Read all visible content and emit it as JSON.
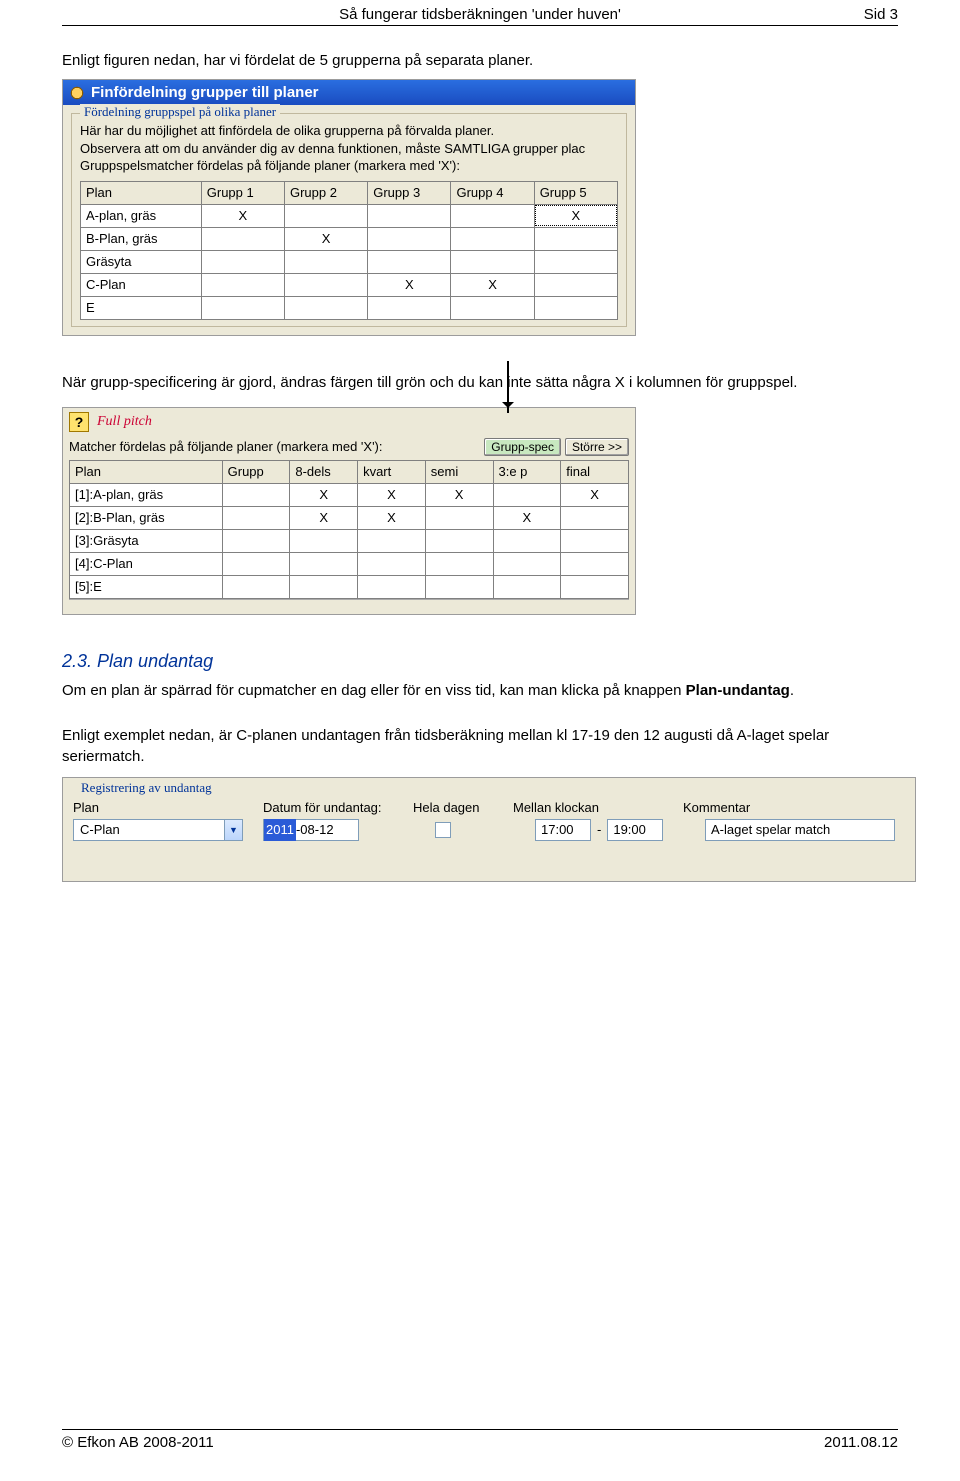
{
  "header": {
    "title": "Så fungerar tidsberäkningen 'under huven'",
    "page_label": "Sid 3"
  },
  "para1": "Enligt figuren nedan, har vi fördelat de 5 grupperna på separata planer.",
  "shot1": {
    "window_title": "Finfördelning grupper till planer",
    "fieldset_legend": "Fördelning gruppspel på olika planer",
    "desc_line1": "Här har du möjlighet att finfördela de olika grupperna på förvalda planer.",
    "desc_line2": "Observera att om du använder dig av denna funktionen, måste SAMTLIGA grupper plac",
    "desc_line3": "Gruppspelsmatcher fördelas på följande planer (markera med 'X'):",
    "cols": [
      "Plan",
      "Grupp 1",
      "Grupp 2",
      "Grupp 3",
      "Grupp 4",
      "Grupp 5"
    ],
    "rows": [
      {
        "plan": "A-plan, gräs",
        "g": [
          "X",
          "",
          "",
          "",
          "X"
        ],
        "focus_col": 5
      },
      {
        "plan": "B-Plan, gräs",
        "g": [
          "",
          "X",
          "",
          "",
          ""
        ]
      },
      {
        "plan": "Gräsyta",
        "g": [
          "",
          "",
          "",
          "",
          ""
        ]
      },
      {
        "plan": "C-Plan",
        "g": [
          "",
          "",
          "X",
          "X",
          ""
        ]
      },
      {
        "plan": "E",
        "g": [
          "",
          "",
          "",
          "",
          ""
        ]
      }
    ]
  },
  "para2": "När grupp-specificering är gjord, ändras färgen till grön och du kan inte sätta några X i kolumnen för gruppspel.",
  "shot2": {
    "fullpitch": "Full pitch",
    "label": "Matcher fördelas på följande planer (markera med 'X'):",
    "btn_gruppspec": "Grupp-spec",
    "btn_storre": "Större >>",
    "cols": [
      "Plan",
      "Grupp",
      "8-dels",
      "kvart",
      "semi",
      "3:e p",
      "final"
    ],
    "rows": [
      {
        "plan": "[1]:A-plan, gräs",
        "v": [
          "",
          "X",
          "X",
          "X",
          "",
          "X"
        ]
      },
      {
        "plan": "[2]:B-Plan, gräs",
        "v": [
          "",
          "X",
          "X",
          "",
          "X",
          ""
        ]
      },
      {
        "plan": "[3]:Gräsyta",
        "v": [
          "",
          "",
          "",
          "",
          "",
          ""
        ]
      },
      {
        "plan": "[4]:C-Plan",
        "v": [
          "",
          "",
          "",
          "",
          "",
          ""
        ]
      },
      {
        "plan": "[5]:E",
        "v": [
          "",
          "",
          "",
          "",
          "",
          ""
        ]
      }
    ]
  },
  "section": {
    "heading": "2.3. Plan undantag",
    "para_a": "Om en plan är spärrad för cupmatcher en dag eller för en viss tid, kan man klicka på knappen ",
    "para_a_bold": "Plan-undantag",
    "para_a_end": ".",
    "para_b": "Enligt exemplet nedan, är C-planen undantagen från tidsberäkning mellan kl 17-19 den 12 augusti då A-laget spelar seriermatch."
  },
  "shot3": {
    "legend": "Registrering av undantag",
    "headers": {
      "plan": "Plan",
      "date": "Datum för undantag:",
      "allday": "Hela dagen",
      "between": "Mellan klockan",
      "comment": "Kommentar"
    },
    "row": {
      "plan": "C-Plan",
      "date_sel": "2011",
      "date_rest": "-08-12",
      "time_from": "17:00",
      "time_to": "19:00",
      "comment": "A-laget spelar match"
    }
  },
  "footer": {
    "left": "© Efkon AB 2008-2011",
    "right": "2011.08.12"
  }
}
